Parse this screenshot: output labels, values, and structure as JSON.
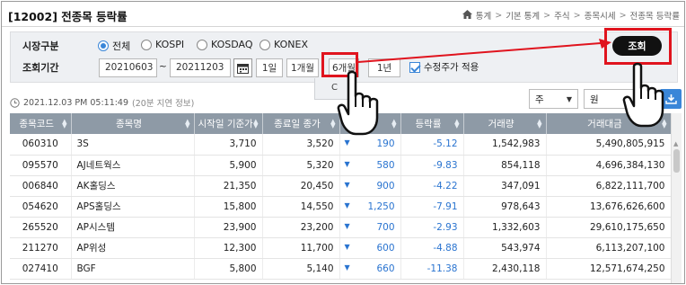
{
  "header": {
    "title": "[12002] 전종목 등락률",
    "breadcrumbs": [
      "통계",
      "기본 통계",
      "주식",
      "종목시세",
      "전종목 등락률"
    ]
  },
  "search": {
    "market_label": "시장구분",
    "markets": [
      "전체",
      "KOSPI",
      "KOSDAQ",
      "KONEX"
    ],
    "selected_market": "전체",
    "period_label": "조회기간",
    "start_date": "20210603",
    "date_separator": "~",
    "end_date": "20211203",
    "periods": [
      "1일",
      "1개월",
      "6개월",
      "1년"
    ],
    "active_period": "6개월",
    "adjusted_price_label": "수정주가 적용",
    "adjusted_price_checked": true,
    "submit_label": "조회",
    "popup_fragment": "C"
  },
  "info": {
    "timestamp": "2021.12.03 PM 05:11:49",
    "delay_note": "(20분 지연 정보)",
    "unit_select": "주",
    "currency_select": "원"
  },
  "table": {
    "columns": [
      "종목코드",
      "종목명",
      "시작일 기준가",
      "종료일 종가",
      "대비",
      "등락률",
      "거래량",
      "거래대금"
    ],
    "rows": [
      {
        "code": "060310",
        "name": "3S",
        "start": "3,710",
        "end": "3,520",
        "change": "190",
        "rate": "-5.12",
        "volume": "1,542,983",
        "amount": "5,490,805,915"
      },
      {
        "code": "095570",
        "name": "AJ네트웍스",
        "start": "5,900",
        "end": "5,320",
        "change": "580",
        "rate": "-9.83",
        "volume": "854,118",
        "amount": "4,696,384,130"
      },
      {
        "code": "006840",
        "name": "AK홀딩스",
        "start": "21,350",
        "end": "20,450",
        "change": "900",
        "rate": "-4.22",
        "volume": "347,091",
        "amount": "6,822,111,700"
      },
      {
        "code": "054620",
        "name": "APS홀딩스",
        "start": "15,800",
        "end": "14,550",
        "change": "1,250",
        "rate": "-7.91",
        "volume": "978,643",
        "amount": "13,676,626,600"
      },
      {
        "code": "265520",
        "name": "AP시스템",
        "start": "23,900",
        "end": "23,200",
        "change": "700",
        "rate": "-2.93",
        "volume": "1,332,603",
        "amount": "29,610,175,650"
      },
      {
        "code": "211270",
        "name": "AP위성",
        "start": "12,300",
        "end": "11,700",
        "change": "600",
        "rate": "-4.88",
        "volume": "543,974",
        "amount": "6,113,207,100"
      },
      {
        "code": "027410",
        "name": "BGF",
        "start": "5,800",
        "end": "5,140",
        "change": "660",
        "rate": "-11.38",
        "volume": "2,430,118",
        "amount": "12,571,674,250"
      }
    ]
  },
  "colors": {
    "accent": "#3a86d8",
    "header_bg": "#8e9aa6",
    "highlight": "#e0141e",
    "down": "#2a74d0"
  },
  "icons": [
    "home-icon",
    "calendar-icon",
    "clock-icon",
    "download-icon",
    "pointing-hand-icon",
    "arrow-icon"
  ]
}
